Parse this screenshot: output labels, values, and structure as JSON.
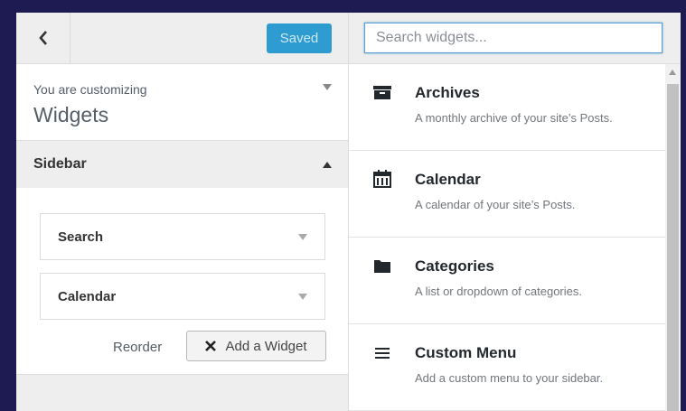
{
  "header": {
    "saved_label": "Saved"
  },
  "customize": {
    "label": "You are customizing",
    "title": "Widgets"
  },
  "section": {
    "title": "Sidebar"
  },
  "sidebar_widgets": [
    {
      "title": "Search"
    },
    {
      "title": "Calendar"
    }
  ],
  "actions": {
    "reorder_label": "Reorder",
    "add_widget_label": "Add a Widget"
  },
  "search": {
    "placeholder": "Search widgets..."
  },
  "available_widgets": [
    {
      "icon": "archive-icon",
      "title": "Archives",
      "description": "A monthly archive of your site’s Posts."
    },
    {
      "icon": "calendar-icon",
      "title": "Calendar",
      "description": "A calendar of your site’s Posts."
    },
    {
      "icon": "folder-icon",
      "title": "Categories",
      "description": "A list or dropdown of categories."
    },
    {
      "icon": "menu-icon",
      "title": "Custom Menu",
      "description": "Add a custom menu to your sidebar."
    }
  ],
  "colors": {
    "accent": "#2e9cd0",
    "focus": "#5b9dd9",
    "background": "#1d1b52"
  }
}
